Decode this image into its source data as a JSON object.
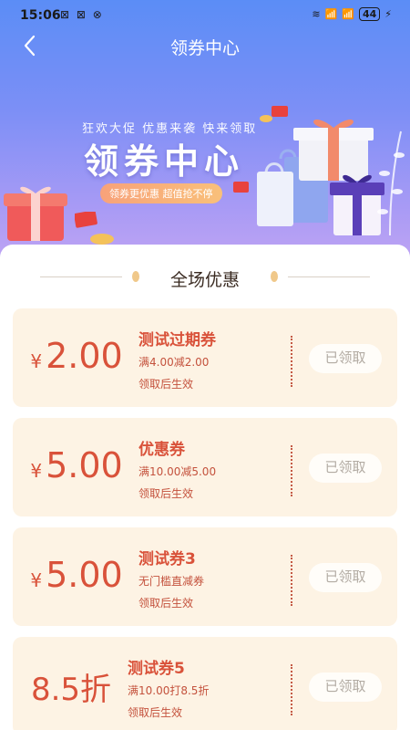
{
  "status": {
    "time": "15:06",
    "left_icons": "N N N",
    "signal": "4G",
    "battery": "44"
  },
  "nav": {
    "title": "领券中心"
  },
  "banner": {
    "subtitle": "狂欢大促 优惠来袭 快来领取",
    "title": "领券中心",
    "pill": "领券更优惠 超值抢不停"
  },
  "section": {
    "title": "全场优惠"
  },
  "coupons": [
    {
      "currency": "¥",
      "amount": "2.00",
      "name": "测试过期券",
      "rule": "满4.00减2.00",
      "valid": "领取后生效",
      "button": "已领取"
    },
    {
      "currency": "¥",
      "amount": "5.00",
      "name": "优惠券",
      "rule": "满10.00减5.00",
      "valid": "领取后生效",
      "button": "已领取"
    },
    {
      "currency": "¥",
      "amount": "5.00",
      "name": "测试券3",
      "rule": "无门槛直减券",
      "valid": "领取后生效",
      "button": "已领取"
    },
    {
      "currency": "",
      "amount": "8.5折",
      "name": "测试券5",
      "rule": "满10.00打8.5折",
      "valid": "领取后生效",
      "button": "已领取"
    }
  ],
  "colors": {
    "accent": "#d9523a",
    "coupon_bg": "#fdf3e4",
    "hero_top": "#5b8df6",
    "hero_bottom": "#c4a6f3"
  }
}
